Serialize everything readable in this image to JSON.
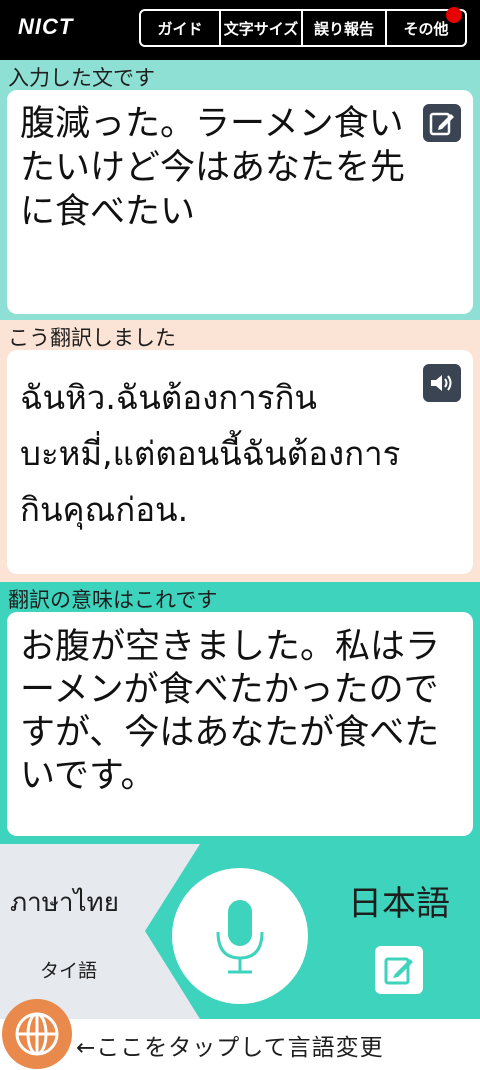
{
  "app": {
    "logo": "NICT"
  },
  "menu": {
    "guide": "ガイド",
    "font_size": "文字サイズ",
    "report": "誤り報告",
    "other": "その他"
  },
  "input_section": {
    "label": "入力した文です",
    "text": "腹減った。ラーメン食いたいけど今はあなたを先に食べたい"
  },
  "translation_section": {
    "label": "こう翻訳しました",
    "text": "ฉันหิว.ฉันต้องการกินบะหมี่,แต่ตอนนี้ฉันต้องการกินคุณก่อน."
  },
  "back_translation_section": {
    "label": "翻訳の意味はこれです",
    "text": "お腹が空きました。私はラーメンが食べたかったのですが、今はあなたが食べたいです。"
  },
  "languages": {
    "source_native": "ภาษาไทย",
    "source_ja": "タイ語",
    "target": "日本語"
  },
  "footer": {
    "hint": "←ここをタップして言語変更"
  },
  "colors": {
    "teal": "#3dd3bd",
    "mint": "#8fe0d4",
    "peach": "#fbe3d6",
    "orange": "#e9894b",
    "badge_red": "#e60000"
  },
  "icons": [
    "edit-icon",
    "speaker-icon",
    "microphone-icon",
    "globe-icon"
  ]
}
